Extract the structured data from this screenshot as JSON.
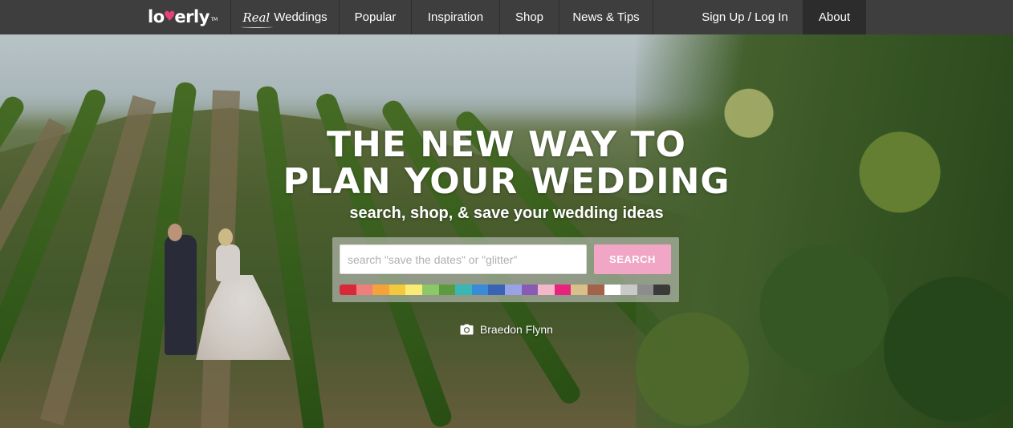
{
  "nav": {
    "logo": {
      "text_start": "lo",
      "text_end": "erly",
      "tm": "TM"
    },
    "items": [
      {
        "script": "Real",
        "label": "Weddings"
      },
      {
        "label": "Popular"
      },
      {
        "label": "Inspiration"
      },
      {
        "label": "Shop"
      },
      {
        "label": "News & Tips"
      }
    ],
    "auth": "Sign Up / Log In",
    "about": "About"
  },
  "hero": {
    "headline_line1": "THE NEW WAY TO",
    "headline_line2": "PLAN YOUR WEDDING",
    "subline": "search, shop, & save your wedding ideas",
    "photo_credit": "Braedon Flynn"
  },
  "search": {
    "placeholder": "search \"save the dates\" or \"glitter\"",
    "value": "",
    "button_label": "SEARCH"
  },
  "colors": {
    "brand_pink": "#e8407c",
    "search_button": "#f2a6c5",
    "swatches": [
      "#d8283a",
      "#ef7f7c",
      "#f4a23a",
      "#f5c73c",
      "#f8ec74",
      "#8dc868",
      "#5b9a3e",
      "#3ab7b5",
      "#3b8ad8",
      "#3a63b6",
      "#9aa2e6",
      "#8a5bb5",
      "#f4b6c9",
      "#e8237e",
      "#d9bf8a",
      "#a5624a",
      "#ffffff",
      "#c9c9c9",
      "#8c8c8c",
      "#3a3a3a"
    ]
  },
  "icons": {
    "camera": "camera-icon",
    "heart": "heart-icon"
  }
}
